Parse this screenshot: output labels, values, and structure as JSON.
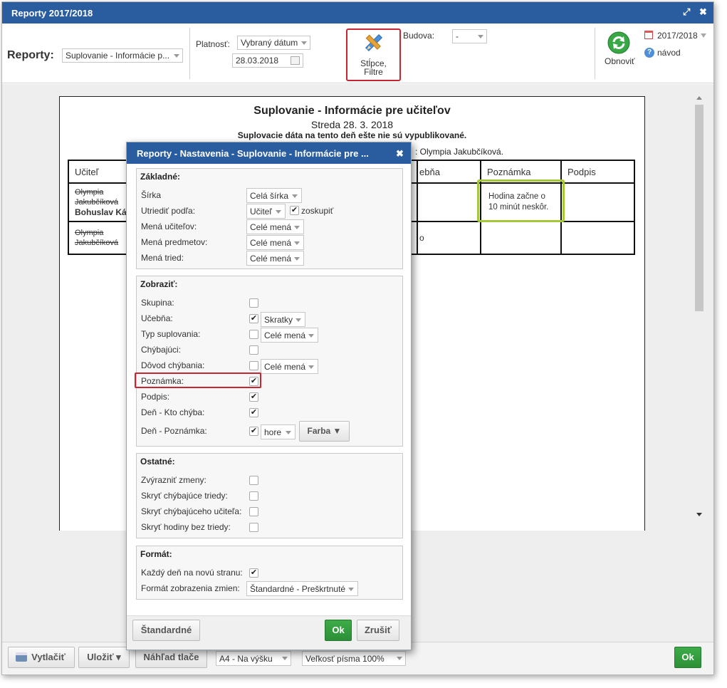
{
  "window": {
    "title": "Reporty 2017/2018",
    "maximize_icon": "⤢",
    "close_icon": "✖"
  },
  "toolbar": {
    "reports_label": "Reporty:",
    "report_select": "Suplovanie - Informácie p...",
    "validity_label": "Platnosť:",
    "validity_select": "Vybraný dátum",
    "date_value": "28.03.2018",
    "columns_button_line1": "Stĺpce,",
    "columns_button_line2": "Filtre",
    "building_label": "Budova:",
    "building_select": "-",
    "refresh_label": "Obnoviť",
    "year_label": "2017/2018",
    "help_label": "návod"
  },
  "report": {
    "title": "Suplovanie - Informácie pre učiteľov",
    "date": "Streda 28. 3. 2018",
    "notice": "Suplovacie dáta na tento deň ešte nie sú vypublikované.",
    "absent_line": ": Olympia Jakubčíková.",
    "headers": [
      "Učiteľ",
      "ebňa",
      "Poznámka",
      "Podpis"
    ],
    "rows": [
      {
        "teacher_struck": "Olympia Jakubčíková",
        "teacher": "Bohuslav Ká",
        "room": "",
        "note": "Hodina začne o 10 minút neskôr.",
        "signature": ""
      },
      {
        "teacher_struck": "Olympia Jakubčíková",
        "teacher": "",
        "room": "o",
        "note": "",
        "signature": ""
      }
    ]
  },
  "bottombar": {
    "print": "Vytlačiť",
    "save": "Uložiť ▾",
    "preview": "Náhľad tlače",
    "paper_select": "A4 - Na výšku",
    "font_select": "Veľkosť písma 100%",
    "ok": "Ok"
  },
  "dialog": {
    "title": "Reporty - Nastavenia - Suplovanie - Informácie pre ...",
    "close_icon": "✖",
    "basic": {
      "heading": "Základné:",
      "width_label": "Šírka",
      "width_value": "Celá šírka",
      "sort_label": "Utriediť podľa:",
      "sort_value": "Učiteľ",
      "group_label": "zoskupiť",
      "group_checked": true,
      "teacher_names_label": "Mená učiteľov:",
      "teacher_names_value": "Celé mená",
      "subject_names_label": "Mená predmetov:",
      "subject_names_value": "Celé mená",
      "class_names_label": "Mená tried:",
      "class_names_value": "Celé mená"
    },
    "show": {
      "heading": "Zobraziť:",
      "items": [
        {
          "label": "Skupina:",
          "checked": false,
          "select": ""
        },
        {
          "label": "Učebňa:",
          "checked": true,
          "select": "Skratky"
        },
        {
          "label": "Typ suplovania:",
          "checked": false,
          "select": "Celé mená"
        },
        {
          "label": "Chýbajúci:",
          "checked": false,
          "select": ""
        },
        {
          "label": "Dôvod chýbania:",
          "checked": false,
          "select": "Celé mená"
        },
        {
          "label": "Poznámka:",
          "checked": true,
          "select": ""
        },
        {
          "label": "Podpis:",
          "checked": true,
          "select": ""
        },
        {
          "label": "Deň - Kto chýba:",
          "checked": true,
          "select": ""
        },
        {
          "label": "Deň - Poznámka:",
          "checked": true,
          "select": "hore"
        }
      ],
      "color_button": "Farba ▼"
    },
    "other": {
      "heading": "Ostatné:",
      "items": [
        {
          "label": "Zvýrazniť zmeny:",
          "checked": false
        },
        {
          "label": "Skryť chýbajúce triedy:",
          "checked": false
        },
        {
          "label": "Skryť chýbajúceho učiteľa:",
          "checked": false
        },
        {
          "label": "Skryť hodiny bez triedy:",
          "checked": false
        }
      ]
    },
    "format": {
      "heading": "Formát:",
      "new_page_label": "Každý deň na novú stranu:",
      "new_page_checked": true,
      "changes_label": "Formát zobrazenia zmien:",
      "changes_value": "Štandardné - Preškrtnuté"
    },
    "footer": {
      "default_button": "Štandardné",
      "ok_button": "Ok",
      "cancel_button": "Zrušiť"
    }
  },
  "colors": {
    "title_bar": "#2a5d9f",
    "highlight_red": "#c62631",
    "highlight_green": "#a5c936",
    "ok_green": "#2d8f38"
  }
}
